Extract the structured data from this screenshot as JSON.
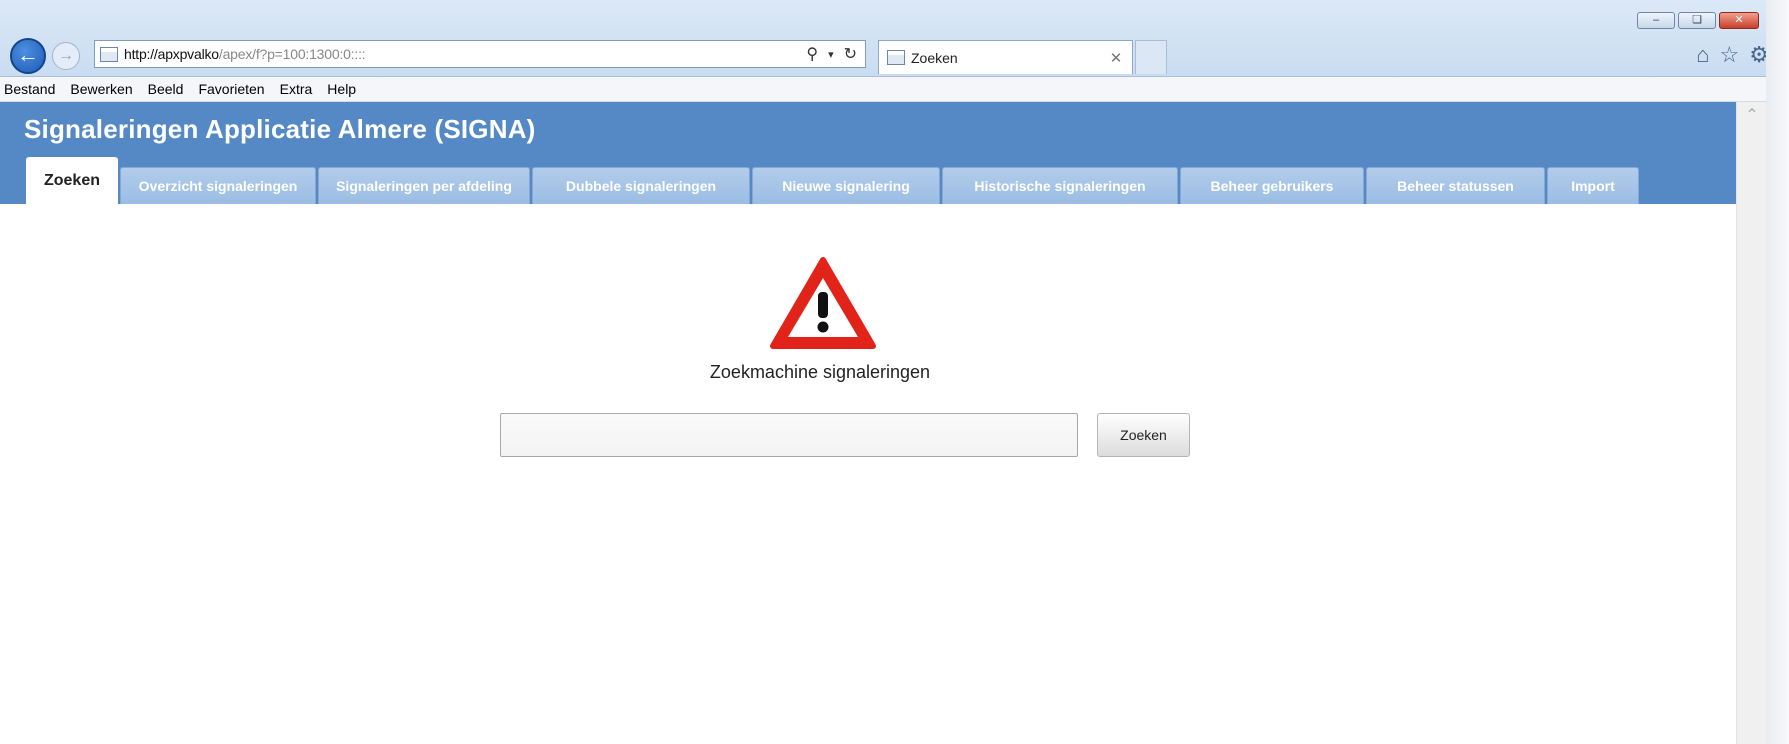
{
  "browser": {
    "url_host": "http://apxpvalko",
    "url_rest": "/apex/f?p=100:1300:0::::",
    "tab_title": "Zoeken",
    "menu": [
      "Bestand",
      "Bewerken",
      "Beeld",
      "Favorieten",
      "Extra",
      "Help"
    ],
    "icons": [
      "back-arrow-icon",
      "forward-arrow-icon",
      "search-icon",
      "refresh-icon",
      "home-icon",
      "star-icon",
      "gear-icon"
    ]
  },
  "app": {
    "title": "Signaleringen Applicatie Almere (SIGNA)",
    "tabs": [
      {
        "label": "Zoeken",
        "active": true
      },
      {
        "label": "Overzicht signaleringen"
      },
      {
        "label": "Signaleringen per afdeling"
      },
      {
        "label": "Dubbele signaleringen"
      },
      {
        "label": "Nieuwe signalering"
      },
      {
        "label": "Historische signaleringen"
      },
      {
        "label": "Beheer gebruikers"
      },
      {
        "label": "Beheer statussen"
      },
      {
        "label": "Import"
      }
    ]
  },
  "search": {
    "heading": "Zoekmachine signaleringen",
    "input_value": "",
    "button_label": "Zoeken"
  },
  "colors": {
    "header_blue": "#5589c6",
    "warning_red": "#e2231a"
  }
}
